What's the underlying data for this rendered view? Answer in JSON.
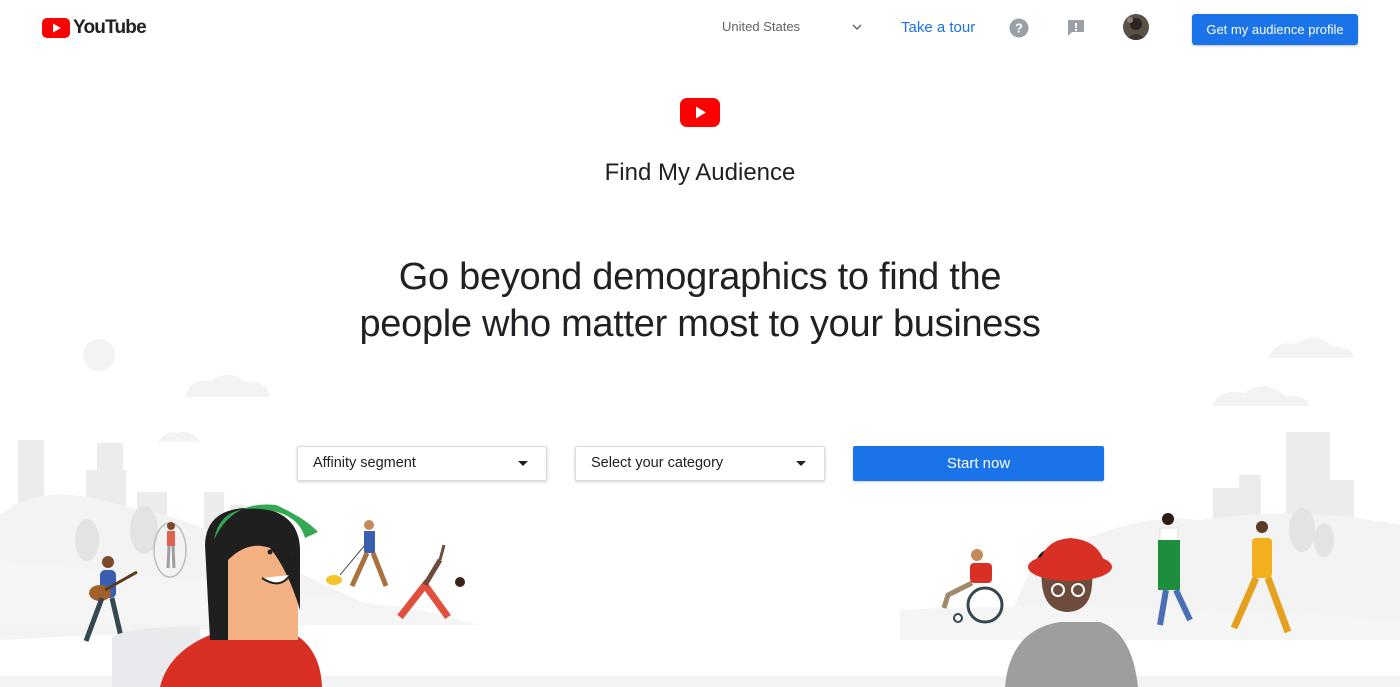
{
  "header": {
    "logo_text": "YouTube",
    "country": "United States",
    "take_tour": "Take a tour",
    "help_icon": "help-circle-icon",
    "feedback_icon": "feedback-icon",
    "profile_button": "Get my audience profile"
  },
  "hero": {
    "app_title": "Find My Audience",
    "headline_line1": "Go beyond demographics to find the",
    "headline_line2": "people who matter most to your business"
  },
  "controls": {
    "segment_select": "Affinity segment",
    "category_select": "Select your category",
    "start_button": "Start now"
  },
  "colors": {
    "brand_red": "#ff0000",
    "accent_blue": "#1a73e8"
  }
}
